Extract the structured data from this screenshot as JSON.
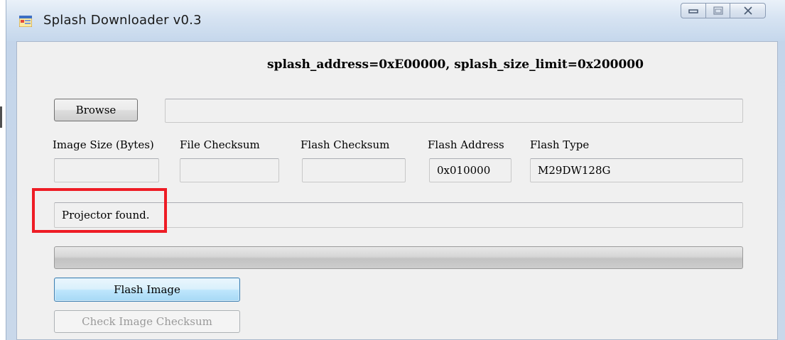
{
  "window": {
    "title": "Splash Downloader  v0.3"
  },
  "header": {
    "info": "splash_address=0xE00000, splash_size_limit=0x200000"
  },
  "file": {
    "browse_label": "Browse",
    "path_value": ""
  },
  "fields": {
    "image_size_label": "Image Size (Bytes)",
    "image_size_value": "",
    "file_checksum_label": "File Checksum",
    "file_checksum_value": "",
    "flash_checksum_label": "Flash Checksum",
    "flash_checksum_value": "",
    "flash_address_label": "Flash Address",
    "flash_address_value": "0x010000",
    "flash_type_label": "Flash Type",
    "flash_type_value": "M29DW128G"
  },
  "status": {
    "message": "Projector found."
  },
  "progress": {
    "fraction": 0
  },
  "actions": {
    "flash_image_label": "Flash Image",
    "check_checksum_label": "Check Image Checksum"
  },
  "annotation": {
    "highlight_color": "#ee1c25"
  },
  "icons": {
    "app": "app-icon",
    "minimize": "minimize-icon",
    "maximize": "maximize-icon",
    "close": "close-icon"
  }
}
